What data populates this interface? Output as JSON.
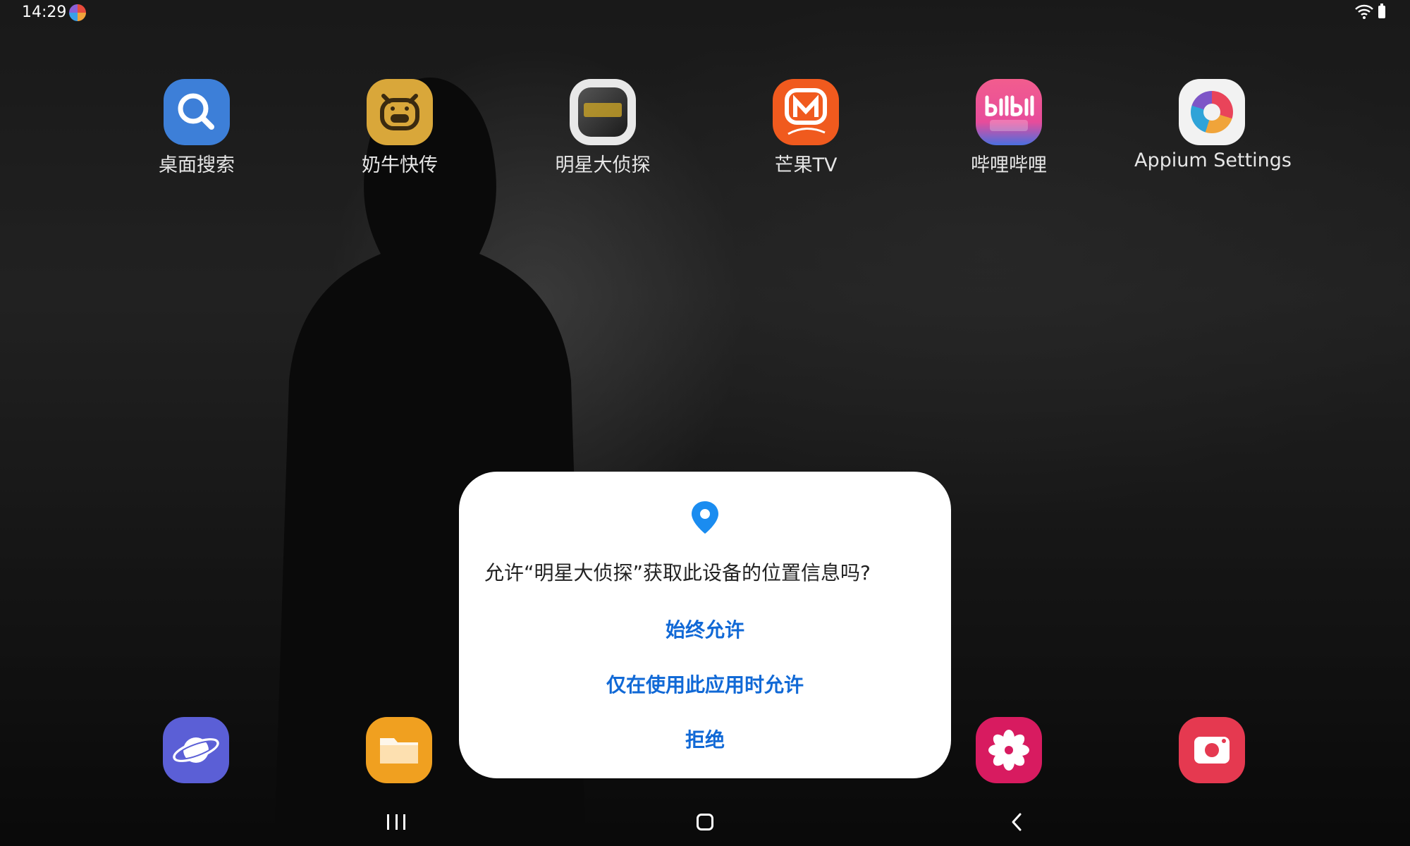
{
  "status_bar": {
    "time": "14:29",
    "notification_icon": "app-notification-icon",
    "wifi_icon": "wifi-icon",
    "battery_icon": "battery-icon"
  },
  "home_apps": [
    {
      "label": "桌面搜索",
      "icon": "search-icon",
      "color": "#3d7fd8"
    },
    {
      "label": "奶牛快传",
      "icon": "cow-icon",
      "color": "#d9a73a"
    },
    {
      "label": "明星大侦探",
      "icon": "show-poster-icon",
      "color": "#3a3a3a"
    },
    {
      "label": "芒果TV",
      "icon": "mango-tv-icon",
      "color": "#f05a1e"
    },
    {
      "label": "哔哩哔哩",
      "icon": "bilibili-icon",
      "color": "#f25d8e"
    },
    {
      "label": "Appium Settings",
      "icon": "appium-icon",
      "color": "#ffffff"
    }
  ],
  "dock_apps": [
    {
      "icon": "internet-browser-icon",
      "color": "#5b5fd6"
    },
    {
      "icon": "my-files-icon",
      "color": "#f0a020"
    },
    {
      "icon": "gallery-flower-icon",
      "color": "#d81b60"
    },
    {
      "icon": "screen-recorder-icon",
      "color": "#e53950"
    }
  ],
  "dialog": {
    "icon": "location-pin-icon",
    "message": "允许“明星大侦探”获取此设备的位置信息吗?",
    "options": [
      "始终允许",
      "仅在使用此应用时允许",
      "拒绝"
    ],
    "accent_color": "#1169d6"
  },
  "nav_bar": {
    "recents_icon": "recents-icon",
    "home_icon": "home-icon",
    "back_icon": "back-icon"
  }
}
